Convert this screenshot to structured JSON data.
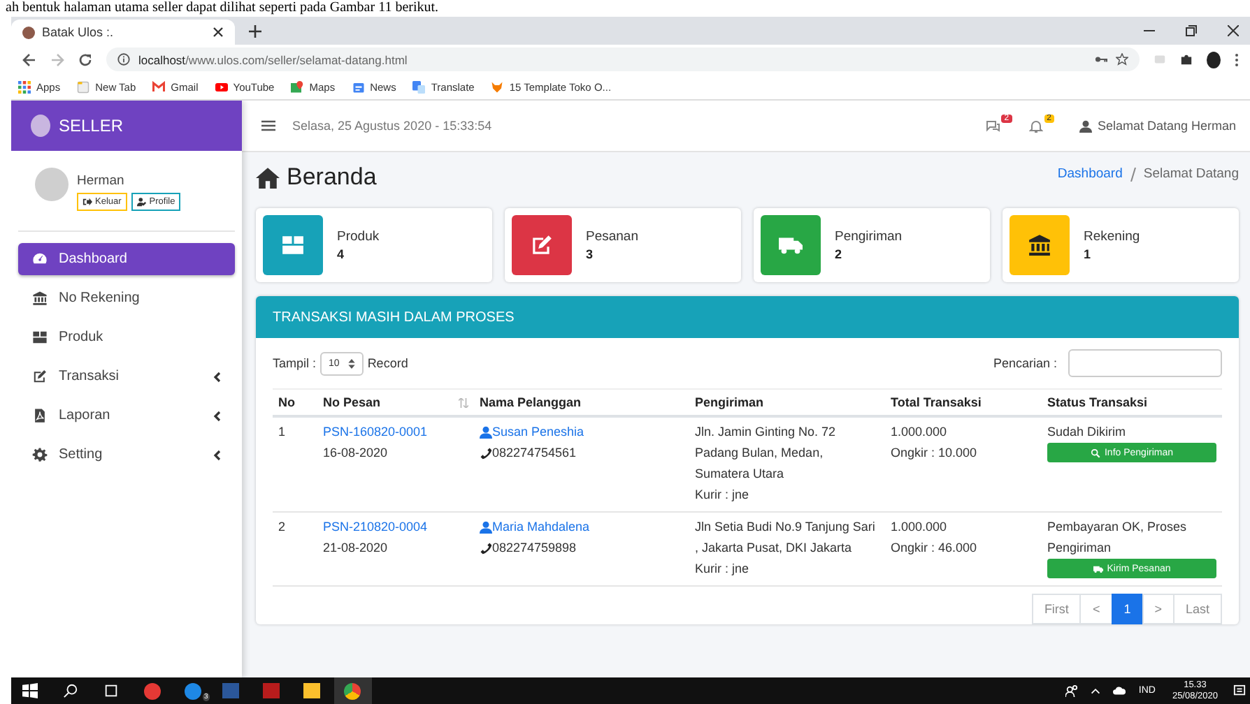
{
  "doc_caption": "ah bentuk halaman utama seller dapat dilihat seperti pada Gambar 11 berikut.",
  "browser": {
    "tab_title": "Batak Ulos :.",
    "url_host": "localhost",
    "url_path": "/www.ulos.com/seller/selamat-datang.html",
    "bookmarks": [
      {
        "label": "Apps",
        "kind": "apps"
      },
      {
        "label": "New Tab",
        "kind": "page"
      },
      {
        "label": "Gmail",
        "kind": "mail"
      },
      {
        "label": "YouTube",
        "kind": "play"
      },
      {
        "label": "Maps",
        "kind": "map"
      },
      {
        "label": "News",
        "kind": "news"
      },
      {
        "label": "Translate",
        "kind": "translate"
      },
      {
        "label": "15 Template Toko O...",
        "kind": "fox"
      }
    ]
  },
  "sidebar": {
    "brand": "SELLER",
    "user": "Herman",
    "buttons": [
      {
        "label": "Keluar",
        "kind": "logout"
      },
      {
        "label": "Profile",
        "kind": "profile"
      }
    ],
    "items": [
      {
        "label": "Dashboard",
        "kind": "gauge",
        "selected": true,
        "submenu": false
      },
      {
        "label": "No Rekening",
        "kind": "bank",
        "selected": false,
        "submenu": false
      },
      {
        "label": "Produk",
        "kind": "box",
        "selected": false,
        "submenu": false
      },
      {
        "label": "Transaksi",
        "kind": "edit",
        "selected": false,
        "submenu": true
      },
      {
        "label": "Laporan",
        "kind": "pdf",
        "selected": false,
        "submenu": true
      },
      {
        "label": "Setting",
        "kind": "gear",
        "selected": false,
        "submenu": true
      }
    ]
  },
  "topbar": {
    "datetime": "Selasa, 25 Agustus 2020 - 15:33:54",
    "messages_badge": "2",
    "notifications_badge": "2",
    "user_label": "Selamat Datang Herman"
  },
  "page": {
    "title": "Beranda",
    "breadcrumb": [
      {
        "label": "Dashboard",
        "link": true
      },
      {
        "label": "Selamat Datang",
        "link": false
      }
    ]
  },
  "stats": [
    {
      "label": "Produk",
      "value": "4",
      "color": "#17a2b8",
      "kind": "box"
    },
    {
      "label": "Pesanan",
      "value": "3",
      "color": "#dc3545",
      "kind": "edit"
    },
    {
      "label": "Pengiriman",
      "value": "2",
      "color": "#28a745",
      "kind": "truck"
    },
    {
      "label": "Rekening",
      "value": "1",
      "color": "#ffc107",
      "kind": "bank"
    }
  ],
  "panel": {
    "title": "TRANSAKSI MASIH DALAM PROSES",
    "show_label": "Tampil :",
    "page_size": "10",
    "record_label": "Record",
    "search_label": "Pencarian :",
    "columns": [
      {
        "label": "No",
        "sortable": false
      },
      {
        "label": "No Pesan",
        "sortable": true
      },
      {
        "label": "Nama Pelanggan",
        "sortable": false
      },
      {
        "label": "Pengiriman",
        "sortable": false
      },
      {
        "label": "Total Transaksi",
        "sortable": false
      },
      {
        "label": "Status Transaksi",
        "sortable": false
      }
    ],
    "rows": [
      {
        "no": "1",
        "order_no": "PSN-160820-0001",
        "date": "16-08-2020",
        "customer": "Susan Peneshia",
        "phone": "082274754561",
        "address": "Jln. Jamin Ginting No. 72 Padang Bulan, Medan, Sumatera Utara",
        "courier": "Kurir : jne",
        "total": "1.000.000",
        "shipping": "Ongkir : 10.000",
        "status": "Sudah Dikirim",
        "action": {
          "label": "Info Pengiriman",
          "kind": "search"
        }
      },
      {
        "no": "2",
        "order_no": "PSN-210820-0004",
        "date": "21-08-2020",
        "customer": "Maria Mahdalena",
        "phone": "082274759898",
        "address": "Jln Setia Budi No.9 Tanjung Sari , Jakarta Pusat, DKI Jakarta",
        "courier": "Kurir : jne",
        "total": "1.000.000",
        "shipping": "Ongkir : 46.000",
        "status": "Pembayaran OK, Proses Pengiriman",
        "action": {
          "label": "Kirim Pesanan",
          "kind": "truck"
        }
      }
    ],
    "pagination": [
      {
        "label": "First",
        "selected": false
      },
      {
        "label": "<",
        "selected": false
      },
      {
        "label": "1",
        "selected": true
      },
      {
        "label": ">",
        "selected": false
      },
      {
        "label": "Last",
        "selected": false
      }
    ]
  },
  "taskbar": {
    "mail_badge": "3",
    "language": "IND",
    "time": "15.33",
    "date": "25/08/2020"
  }
}
